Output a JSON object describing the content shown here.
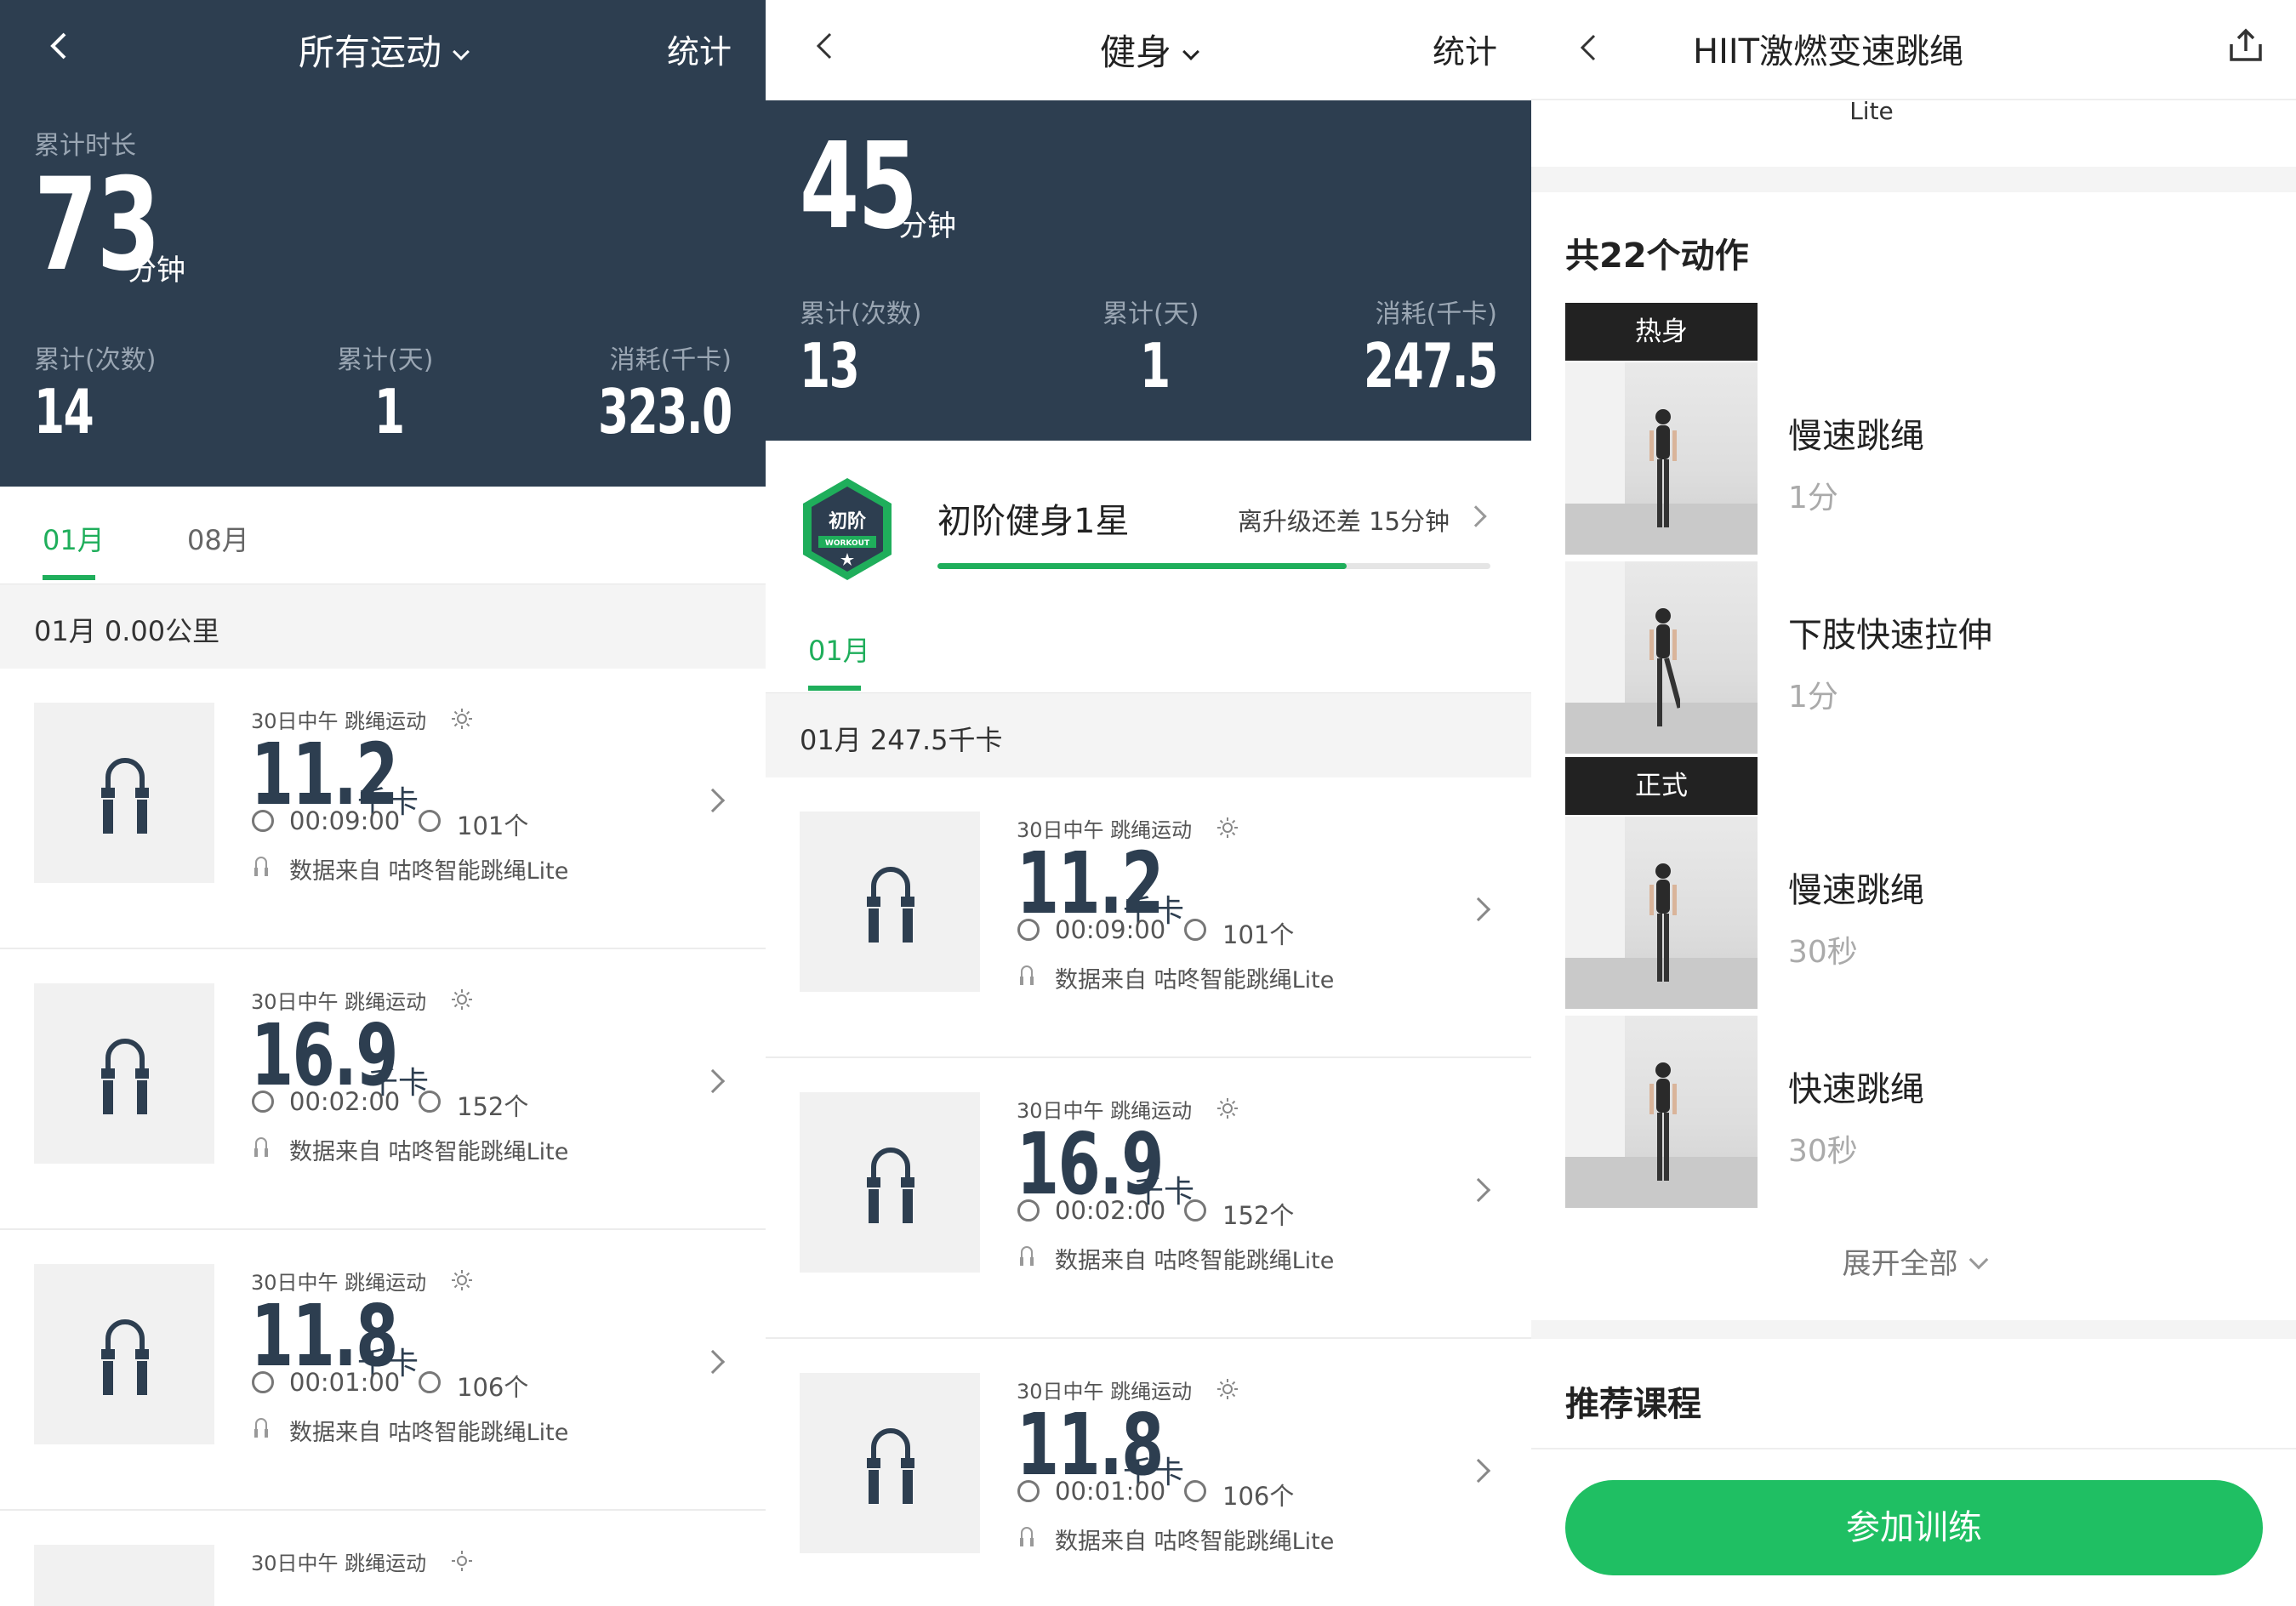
{
  "panel1": {
    "header": {
      "title": "所有运动",
      "right_label": "统计"
    },
    "summary": {
      "duration_label": "累计时长",
      "duration_value": "73",
      "duration_unit": "分钟",
      "count_label": "累计(次数)",
      "count_value": "14",
      "days_label": "累计(天)",
      "days_value": "1",
      "kcal_label": "消耗(千卡)",
      "kcal_value": "323.0"
    },
    "tabs": [
      {
        "label": "01月",
        "active": true
      },
      {
        "label": "08月",
        "active": false
      }
    ],
    "month_summary": "01月  0.00公里",
    "records": [
      {
        "title": "30日中午 跳绳运动",
        "kcal": "11.2",
        "unit": "千卡",
        "time": "00:09:00",
        "count": "101个",
        "source": "数据来自 咕咚智能跳绳Lite"
      },
      {
        "title": "30日中午 跳绳运动",
        "kcal": "16.9",
        "unit": "千卡",
        "time": "00:02:00",
        "count": "152个",
        "source": "数据来自 咕咚智能跳绳Lite"
      },
      {
        "title": "30日中午 跳绳运动",
        "kcal": "11.8",
        "unit": "千卡",
        "time": "00:01:00",
        "count": "106个",
        "source": "数据来自 咕咚智能跳绳Lite"
      },
      {
        "title": "30日中午 跳绳运动"
      }
    ]
  },
  "panel2": {
    "header": {
      "title": "健身",
      "right_label": "统计"
    },
    "summary": {
      "duration_value": "45",
      "duration_unit": "分钟",
      "count_label": "累计(次数)",
      "count_value": "13",
      "days_label": "累计(天)",
      "days_value": "1",
      "kcal_label": "消耗(千卡)",
      "kcal_value": "247.5"
    },
    "level": {
      "badge_text": "初阶",
      "badge_sub": "WORKOUT",
      "name": "初阶健身1星",
      "progress_text": "离升级还差 15分钟",
      "progress": 0.74
    },
    "tabs": [
      {
        "label": "01月",
        "active": true
      }
    ],
    "month_summary": "01月  247.5千卡",
    "records": [
      {
        "title": "30日中午 跳绳运动",
        "kcal": "11.2",
        "unit": "千卡",
        "time": "00:09:00",
        "count": "101个",
        "source": "数据来自 咕咚智能跳绳Lite"
      },
      {
        "title": "30日中午 跳绳运动",
        "kcal": "16.9",
        "unit": "千卡",
        "time": "00:02:00",
        "count": "152个",
        "source": "数据来自 咕咚智能跳绳Lite"
      },
      {
        "title": "30日中午 跳绳运动",
        "kcal": "11.8",
        "unit": "千卡",
        "time": "00:01:00",
        "count": "106个",
        "source": "数据来自 咕咚智能跳绳Lite"
      }
    ]
  },
  "panel3": {
    "header": {
      "title": "HIIT激燃变速跳绳"
    },
    "device_label": "Lite",
    "actions_title": "共22个动作",
    "sections": [
      {
        "label": "热身"
      },
      {
        "label": "正式"
      }
    ],
    "exercises": [
      {
        "name": "慢速跳绳",
        "duration": "1分"
      },
      {
        "name": "下肢快速拉伸",
        "duration": "1分"
      },
      {
        "name": "慢速跳绳",
        "duration": "30秒"
      },
      {
        "name": "快速跳绳",
        "duration": "30秒"
      }
    ],
    "expand_label": "展开全部",
    "recommend_title": "推荐课程",
    "join_button": "参加训练"
  },
  "colors": {
    "header_bg": "#2d3e50",
    "accent_green": "#1fae5b",
    "button_green": "#1fbf63"
  }
}
